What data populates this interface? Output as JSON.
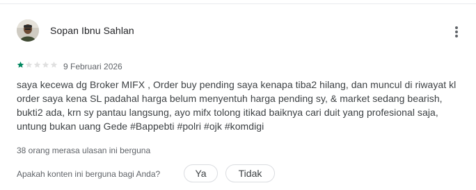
{
  "review": {
    "reviewer_name": "Sopan Ibnu Sahlan",
    "rating": 1,
    "rating_max": 5,
    "date": "9 Februari 2026",
    "text": "saya kecewa dg Broker MIFX , Order buy pending saya kenapa tiba2 hilang, dan muncul di riwayat kl order saya kena SL padahal harga belum menyentuh harga pending sy, & market sedang bearish, bukti2 ada, krn sy pantau langsung, ayo mifx tolong itikad baiknya cari duit yang profesional saja, untung bukan uang Gede #Bappebti #polri #ojk #komdigi",
    "helpful_count_text": "38 orang merasa ulasan ini berguna",
    "helpful_question": "Apakah konten ini berguna bagi Anda?",
    "yes_label": "Ya",
    "no_label": "Tidak"
  },
  "icons": {
    "more": "more-vert-icon",
    "star": "star-icon"
  },
  "colors": {
    "star_filled": "#01875f",
    "star_empty": "#e0e0e0",
    "text_primary": "#202124",
    "text_secondary": "#5f6368"
  }
}
